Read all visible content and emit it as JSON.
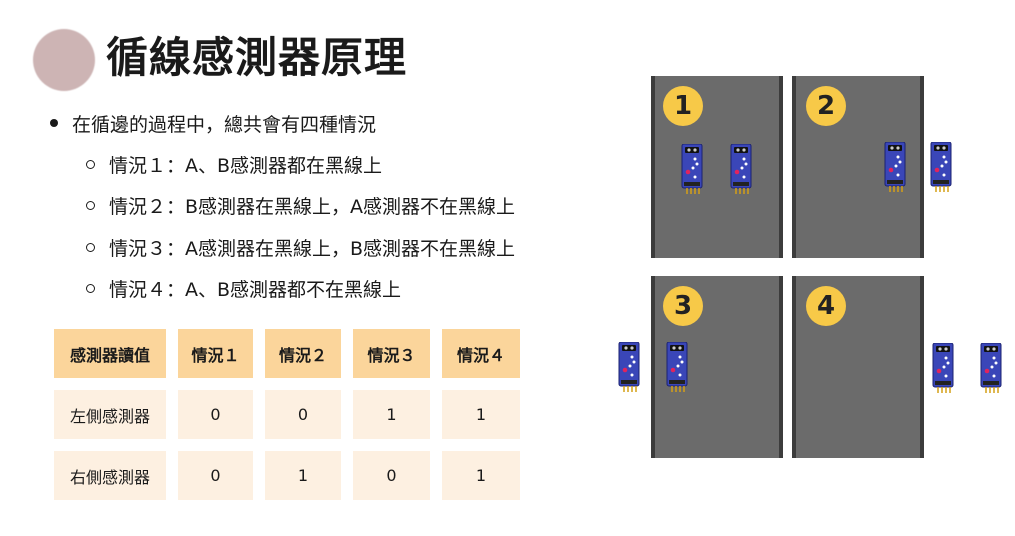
{
  "title": "循線感測器原理",
  "bullet": "在循邊的過程中，總共會有四種情況",
  "cases": [
    "情況１：A、B感測器都在黑線上",
    "情況２：B感測器在黑線上，A感測器不在黑線上",
    "情況３：A感測器在黑線上，B感測器不在黑線上",
    "情況４：A、B感測器都不在黑線上"
  ],
  "table": {
    "headers": [
      "感測器讀值",
      "情況１",
      "情況２",
      "情況３",
      "情況４"
    ],
    "rows": [
      [
        "左側感測器",
        "0",
        "0",
        "1",
        "1"
      ],
      [
        "右側感測器",
        "0",
        "1",
        "0",
        "1"
      ]
    ]
  },
  "panels": [
    "1",
    "2",
    "3",
    "4"
  ],
  "colors": {
    "accent": "#fbd59b",
    "cell": "#fdf0e1",
    "badge": "#f7c948",
    "panel": "#6b6b6b",
    "sensor": "#3a46b8"
  }
}
